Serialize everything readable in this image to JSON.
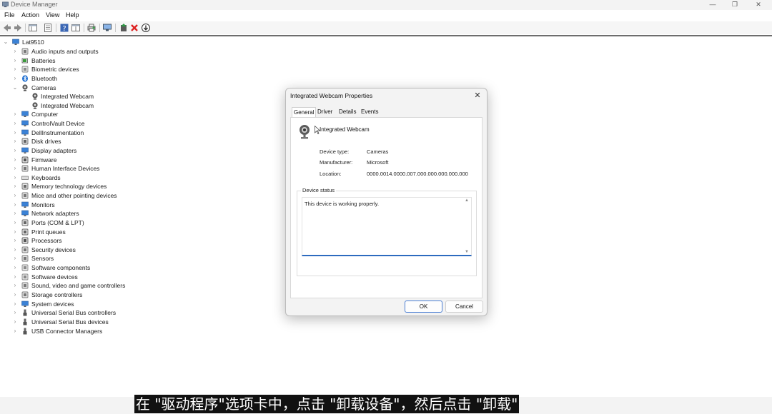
{
  "window": {
    "title": "Device Manager",
    "minimize_glyph": "—",
    "maximize_glyph": "❐",
    "close_glyph": "✕"
  },
  "menu": [
    "File",
    "Action",
    "View",
    "Help"
  ],
  "toolbar_icons": [
    "back-icon",
    "forward-icon",
    "show-hide-tree-icon",
    "properties-icon",
    "help-icon",
    "view-icon",
    "print-icon",
    "scan-hardware-icon",
    "add-driver-icon",
    "uninstall-device-icon",
    "download-update-icon"
  ],
  "tree": {
    "root": "Lat9510",
    "items": [
      {
        "label": "Audio inputs and outputs",
        "expanded": false,
        "icon": "speaker-icon"
      },
      {
        "label": "Batteries",
        "expanded": false,
        "icon": "battery-icon"
      },
      {
        "label": "Biometric devices",
        "expanded": false,
        "icon": "fingerprint-icon"
      },
      {
        "label": "Bluetooth",
        "expanded": false,
        "icon": "bluetooth-icon"
      },
      {
        "label": "Cameras",
        "expanded": true,
        "icon": "camera-icon"
      },
      {
        "label": "Integrated Webcam",
        "child": true,
        "icon": "webcam-icon"
      },
      {
        "label": "Integrated Webcam",
        "child": true,
        "icon": "webcam-icon"
      },
      {
        "label": "Computer",
        "expanded": false,
        "icon": "computer-icon"
      },
      {
        "label": "ControlVault Device",
        "expanded": false,
        "icon": "monitor-icon"
      },
      {
        "label": "DellInstrumentation",
        "expanded": false,
        "icon": "monitor-icon"
      },
      {
        "label": "Disk drives",
        "expanded": false,
        "icon": "disk-icon"
      },
      {
        "label": "Display adapters",
        "expanded": false,
        "icon": "display-icon"
      },
      {
        "label": "Firmware",
        "expanded": false,
        "icon": "chip-icon"
      },
      {
        "label": "Human Interface Devices",
        "expanded": false,
        "icon": "hid-icon"
      },
      {
        "label": "Keyboards",
        "expanded": false,
        "icon": "keyboard-icon"
      },
      {
        "label": "Memory technology devices",
        "expanded": false,
        "icon": "memory-icon"
      },
      {
        "label": "Mice and other pointing devices",
        "expanded": false,
        "icon": "mouse-icon"
      },
      {
        "label": "Monitors",
        "expanded": false,
        "icon": "monitor-icon"
      },
      {
        "label": "Network adapters",
        "expanded": false,
        "icon": "network-icon"
      },
      {
        "label": "Ports (COM & LPT)",
        "expanded": false,
        "icon": "port-icon"
      },
      {
        "label": "Print queues",
        "expanded": false,
        "icon": "printer-icon"
      },
      {
        "label": "Processors",
        "expanded": false,
        "icon": "cpu-icon"
      },
      {
        "label": "Security devices",
        "expanded": false,
        "icon": "security-icon"
      },
      {
        "label": "Sensors",
        "expanded": false,
        "icon": "sensor-icon"
      },
      {
        "label": "Software components",
        "expanded": false,
        "icon": "software-icon"
      },
      {
        "label": "Software devices",
        "expanded": false,
        "icon": "software-icon"
      },
      {
        "label": "Sound, video and game controllers",
        "expanded": false,
        "icon": "speaker-icon"
      },
      {
        "label": "Storage controllers",
        "expanded": false,
        "icon": "storage-icon"
      },
      {
        "label": "System devices",
        "expanded": false,
        "icon": "system-icon"
      },
      {
        "label": "Universal Serial Bus controllers",
        "expanded": false,
        "icon": "usb-icon"
      },
      {
        "label": "Universal Serial Bus devices",
        "expanded": false,
        "icon": "usb-icon"
      },
      {
        "label": "USB Connector Managers",
        "expanded": false,
        "icon": "usb-icon"
      }
    ]
  },
  "dialog": {
    "title": "Integrated Webcam Properties",
    "tabs": [
      "General",
      "Driver",
      "Details",
      "Events"
    ],
    "active_tab": "General",
    "device_name": "Integrated Webcam",
    "device_type_label": "Device type:",
    "device_type": "Cameras",
    "manufacturer_label": "Manufacturer:",
    "manufacturer": "Microsoft",
    "location_label": "Location:",
    "location": "0000.0014.0000.007.000.000.000.000.000",
    "status_caption": "Device status",
    "status_text": "This device is working properly.",
    "ok_label": "OK",
    "cancel_label": "Cancel"
  },
  "subtitle": "在 \"驱动程序\"选项卡中，点击 \"卸载设备\"，然后点击 \"卸载\"",
  "colors": {
    "accent": "#2d6bbf",
    "subtitle_bg": "#111111"
  }
}
